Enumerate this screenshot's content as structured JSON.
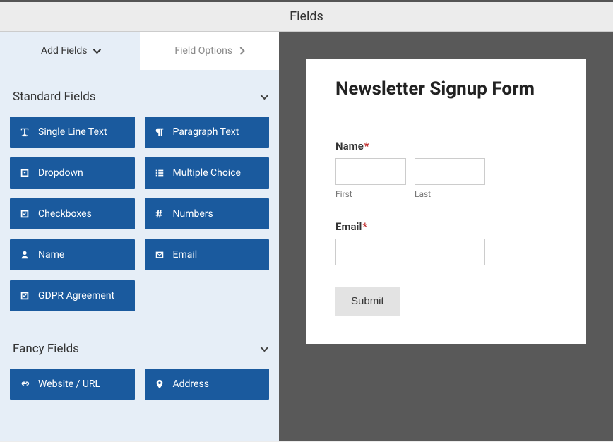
{
  "header": {
    "title": "Fields"
  },
  "tabs": {
    "add_fields": "Add Fields",
    "field_options": "Field Options"
  },
  "sections": {
    "standard": {
      "title": "Standard Fields",
      "items": [
        {
          "label": "Single Line Text",
          "icon": "text-width"
        },
        {
          "label": "Paragraph Text",
          "icon": "paragraph"
        },
        {
          "label": "Dropdown",
          "icon": "caret-square"
        },
        {
          "label": "Multiple Choice",
          "icon": "list"
        },
        {
          "label": "Checkboxes",
          "icon": "check-square"
        },
        {
          "label": "Numbers",
          "icon": "hash"
        },
        {
          "label": "Name",
          "icon": "user"
        },
        {
          "label": "Email",
          "icon": "envelope"
        },
        {
          "label": "GDPR Agreement",
          "icon": "check-square"
        }
      ]
    },
    "fancy": {
      "title": "Fancy Fields",
      "items": [
        {
          "label": "Website / URL",
          "icon": "link"
        },
        {
          "label": "Address",
          "icon": "map-marker"
        }
      ]
    }
  },
  "preview": {
    "form_title": "Newsletter Signup Form",
    "fields": {
      "name": {
        "label": "Name",
        "required": "*",
        "first": "First",
        "last": "Last"
      },
      "email": {
        "label": "Email",
        "required": "*"
      }
    },
    "submit": "Submit"
  }
}
